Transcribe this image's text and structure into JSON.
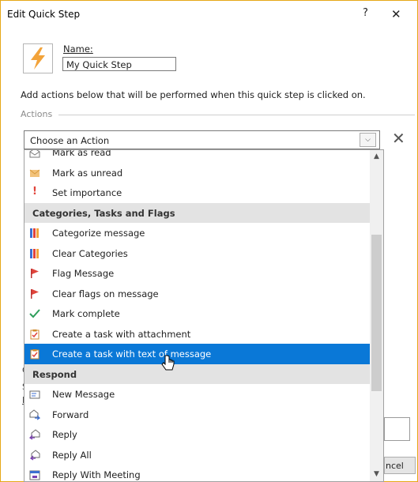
{
  "window": {
    "title": "Edit Quick Step",
    "help_label": "?",
    "close_label": "✕"
  },
  "name_section": {
    "label": "Name:",
    "value": "My Quick Step"
  },
  "instruction": "Add actions below that will be performed when this quick step is clicked on.",
  "actions_label": "Actions",
  "action_combo": {
    "value": "Choose an Action"
  },
  "dropdown": {
    "items": [
      {
        "label": "Mark as read",
        "icon": "envelope-open-icon",
        "type": "item"
      },
      {
        "label": "Mark as unread",
        "icon": "envelope-icon",
        "type": "item"
      },
      {
        "label": "Set importance",
        "icon": "exclamation-icon",
        "type": "item"
      },
      {
        "label": "Categories, Tasks and Flags",
        "type": "header"
      },
      {
        "label": "Categorize message",
        "icon": "category-grid-icon",
        "type": "item"
      },
      {
        "label": "Clear Categories",
        "icon": "category-grid-icon",
        "type": "item"
      },
      {
        "label": "Flag Message",
        "icon": "red-flag-icon",
        "type": "item"
      },
      {
        "label": "Clear flags on message",
        "icon": "red-flag-icon",
        "type": "item"
      },
      {
        "label": "Mark complete",
        "icon": "checkmark-icon",
        "type": "item"
      },
      {
        "label": "Create a task with attachment",
        "icon": "task-clipboard-icon",
        "type": "item"
      },
      {
        "label": "Create a task with text of message",
        "icon": "task-clipboard-icon",
        "type": "item",
        "selected": true
      },
      {
        "label": "Respond",
        "type": "header"
      },
      {
        "label": "New Message",
        "icon": "new-message-icon",
        "type": "item"
      },
      {
        "label": "Forward",
        "icon": "forward-icon",
        "type": "item"
      },
      {
        "label": "Reply",
        "icon": "reply-icon",
        "type": "item"
      },
      {
        "label": "Reply All",
        "icon": "reply-all-icon",
        "type": "item"
      },
      {
        "label": "Reply With Meeting",
        "icon": "reply-meeting-icon",
        "type": "item"
      }
    ]
  },
  "background": {
    "obscured_button_text": "ncel",
    "obscured_letters": [
      "O",
      "S",
      "I"
    ]
  },
  "colors": {
    "accent": "#0a78d7",
    "frame_border": "#e6a817",
    "bolt": "#f2a33a",
    "flag": "#e0443b",
    "check": "#2e9e5b"
  }
}
